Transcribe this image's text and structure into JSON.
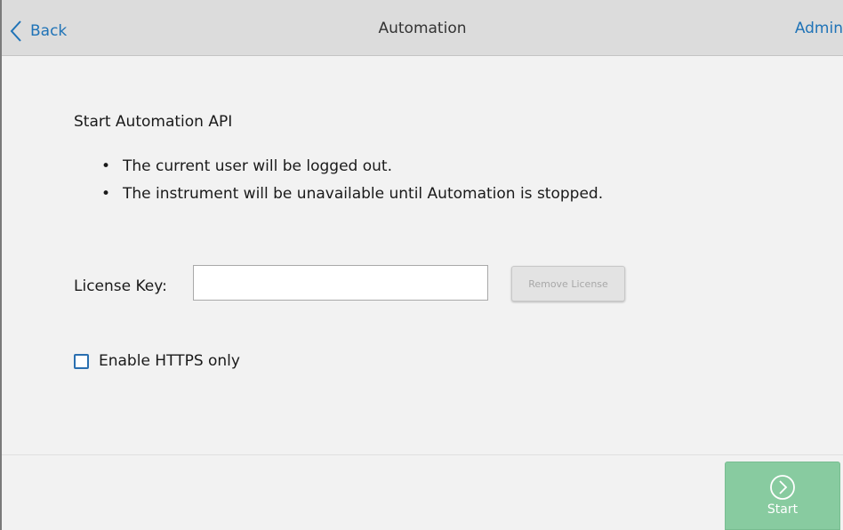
{
  "header": {
    "back_label": "Back",
    "title": "Automation",
    "admin_label": "Admin"
  },
  "content": {
    "section_title": "Start Automation API",
    "bullets": [
      "The current user will be logged out.",
      "The instrument will be unavailable until Automation is stopped."
    ],
    "bullet_symbol": "•",
    "license": {
      "label": "License Key:",
      "value": "",
      "placeholder": ""
    },
    "remove_license_label": "Remove License",
    "https": {
      "label": "Enable HTTPS only",
      "checked": false
    }
  },
  "footer": {
    "start_label": "Start"
  },
  "colors": {
    "accent": "#1f73b7",
    "header_bg": "#dcdcdc",
    "start_bg": "#88cba0",
    "disabled_text": "#a8a8a8"
  },
  "icons": {
    "back": "chevron-left-icon",
    "start": "circle-chevron-right-icon"
  }
}
